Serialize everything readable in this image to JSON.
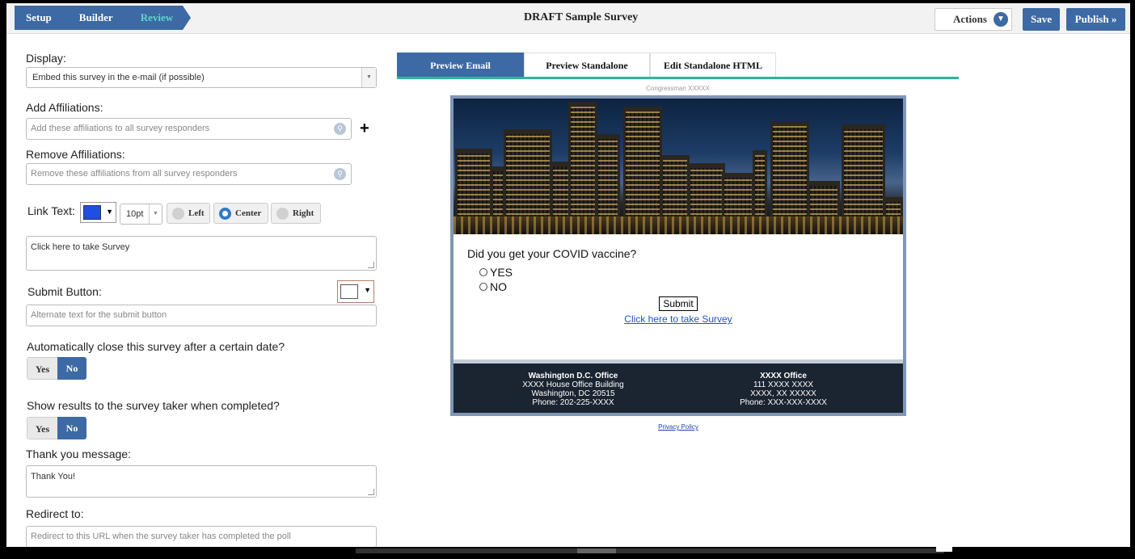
{
  "topbar": {
    "breadcrumbs": [
      {
        "label": "Setup"
      },
      {
        "label": "Builder"
      },
      {
        "label": "Review"
      }
    ],
    "survey_title": "DRAFT Sample Survey",
    "actions_label": "Actions",
    "save_label": "Save",
    "publish_label": "Publish »"
  },
  "left": {
    "display_label": "Display:",
    "display_value": "Embed this survey in the e-mail (if possible)",
    "add_affiliations_label": "Add Affiliations:",
    "add_affiliations_placeholder": "Add these affiliations to all survey responders",
    "plus_glyph": "+",
    "remove_affiliations_label": "Remove Affiliations:",
    "remove_affiliations_placeholder": "Remove these affiliations from all survey responders",
    "link_text_label": "Link Text:",
    "link_color": "#1f4fe0",
    "font_size": "10pt",
    "align_left": "Left",
    "align_center": "Center",
    "align_right": "Right",
    "link_text_value": "Click here to take Survey",
    "submit_button_label": "Submit Button:",
    "submit_button_placeholder": "Alternate text for the submit button",
    "auto_close_label": "Automatically close this survey after a certain date?",
    "auto_close_yes": "Yes",
    "auto_close_no": "No",
    "show_results_label": "Show results to the survey taker when completed?",
    "show_results_yes": "Yes",
    "show_results_no": "No",
    "thank_you_label": "Thank you message:",
    "thank_you_value": "Thank You!",
    "redirect_label": "Redirect to:",
    "redirect_placeholder": "Redirect to this URL when the survey taker has completed the poll"
  },
  "preview": {
    "tabs": [
      {
        "label": "Preview Email"
      },
      {
        "label": "Preview Standalone"
      },
      {
        "label": "Edit Standalone HTML"
      }
    ],
    "header_text": "Congressman XXXXX",
    "question": "Did you get your COVID vaccine?",
    "options": [
      "YES",
      "NO"
    ],
    "submit_label": "Submit",
    "take_survey_link": "Click here to take Survey",
    "offices": [
      {
        "name": "Washington D.C. Office",
        "line1": "XXXX House Office Building",
        "line2": "Washington, DC 20515",
        "line3": "Phone: 202-225-XXXX"
      },
      {
        "name": "XXXX Office",
        "line1": "111 XXXX XXXX",
        "line2": "XXXX, XX XXXXX",
        "line3": "Phone: XXX-XXX-XXXX"
      }
    ],
    "privacy_link": "Privacy Policy"
  },
  "colors": {
    "accent": "#3d69a4",
    "active_crumb": "#5fd6c7",
    "tab_underline": "#2bb89a",
    "footer_bg": "#1b2431"
  }
}
